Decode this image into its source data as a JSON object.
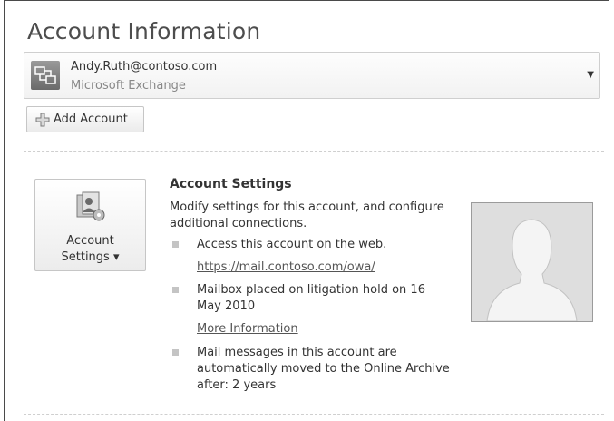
{
  "header": {
    "title": "Account Information"
  },
  "account": {
    "email": "Andy.Ruth@contoso.com",
    "type": "Microsoft Exchange"
  },
  "buttons": {
    "add_account": "Add Account",
    "account_settings_line1": "Account",
    "account_settings_line2": "Settings ▾"
  },
  "account_settings": {
    "heading": "Account Settings",
    "description": "Modify settings for this account, and configure additional connections.",
    "items": [
      {
        "text": "Access this account on the web.",
        "link": "https://mail.contoso.com/owa/"
      },
      {
        "text": "Mailbox placed on litigation hold on 16 May 2010",
        "link": "More Information"
      },
      {
        "text": "Mail messages in this account are automatically moved to the Online Archive after: 2 years"
      }
    ]
  },
  "icons": {
    "account": "exchange-account-icon",
    "add": "add-plus-icon",
    "settings": "account-settings-icon",
    "avatar": "profile-silhouette-icon",
    "dropdown": "chevron-down-icon"
  }
}
